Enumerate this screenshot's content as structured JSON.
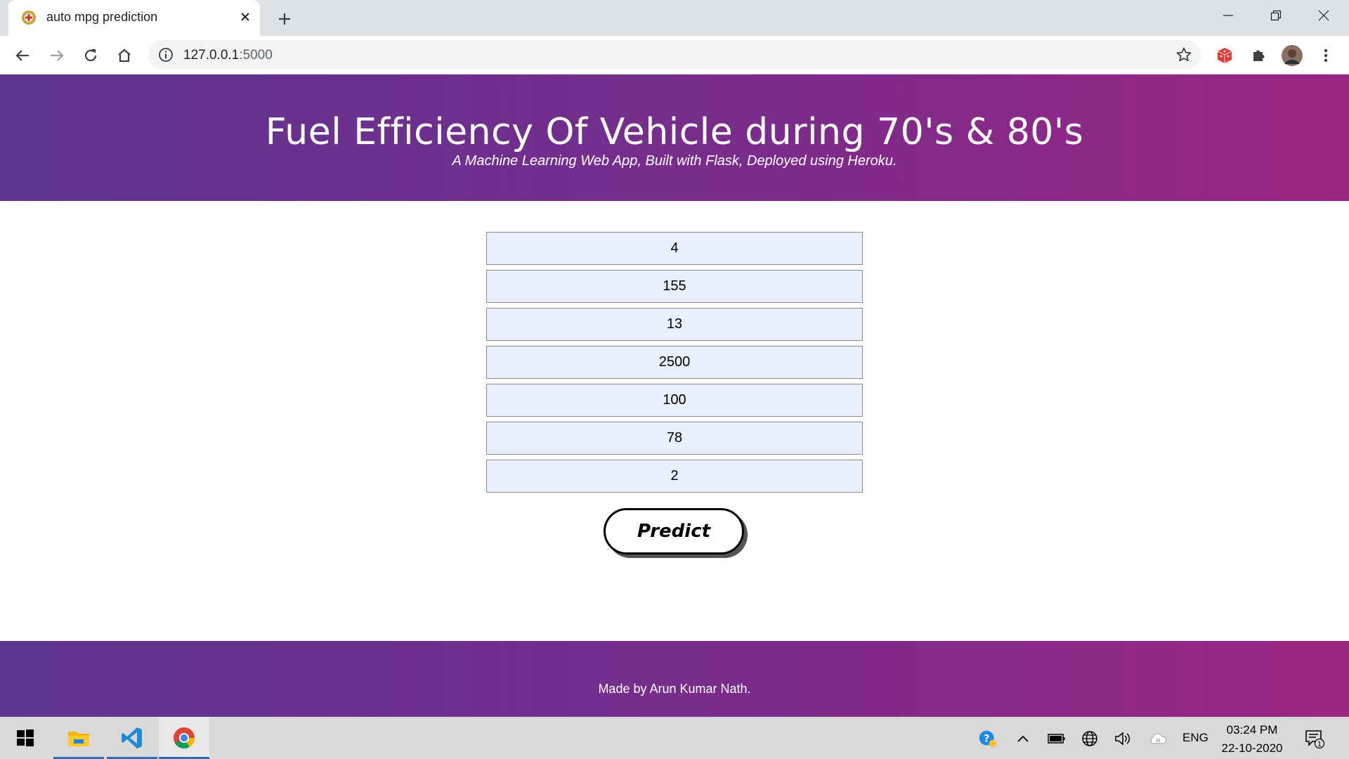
{
  "browser": {
    "tab_title": "auto mpg prediction",
    "url_host": "127.0.0.1",
    "url_port": ":5000"
  },
  "header": {
    "title": "Fuel Efficiency Of Vehicle during 70's & 80's",
    "subtitle": "A Machine Learning Web App, Built with Flask, Deployed using Heroku."
  },
  "form": {
    "fields": [
      "4",
      "155",
      "13",
      "2500",
      "100",
      "78",
      "2"
    ],
    "predict_label": "Predict"
  },
  "footer": {
    "text": "Made by Arun Kumar Nath."
  },
  "taskbar": {
    "language": "ENG",
    "time": "03:24 PM",
    "date": "22-10-2020",
    "notification_count": "1"
  },
  "colors": {
    "header_gradient_start": "#5d3590",
    "header_gradient_end": "#9b2582",
    "input_background": "#e8f0fe"
  }
}
